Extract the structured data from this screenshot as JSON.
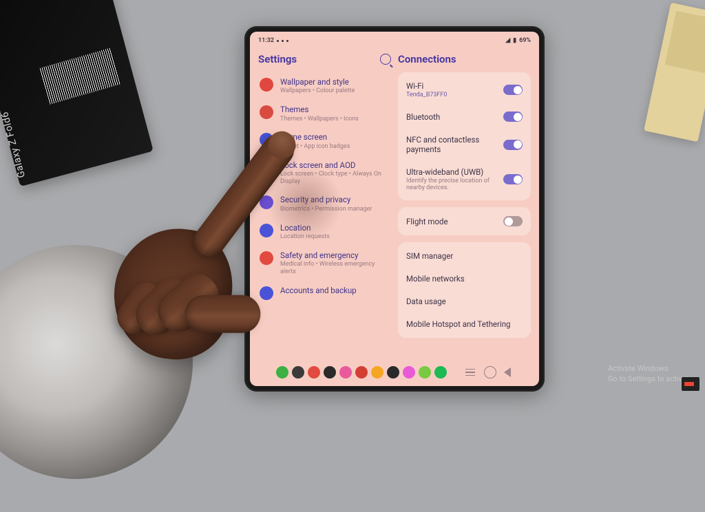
{
  "device_label": "Galaxy Z Fold6",
  "status": {
    "time": "11:32",
    "battery": "69%"
  },
  "left": {
    "title": "Settings",
    "items": [
      {
        "icon": "#e0483f",
        "title": "Wallpaper and style",
        "sub": "Wallpapers • Colour palette"
      },
      {
        "icon": "#d94a3f",
        "title": "Themes",
        "sub": "Themes • Wallpapers • Icons"
      },
      {
        "icon": "#4654d6",
        "title": "Home screen",
        "sub": "Layout • App icon badges"
      },
      {
        "icon": "#5a50c4",
        "title": "Lock screen and AOD",
        "sub": "Lock screen • Clock type • Always On Display"
      },
      {
        "icon": "#6a4fd0",
        "title": "Security and privacy",
        "sub": "Biometrics • Permission manager"
      },
      {
        "icon": "#4a52d8",
        "title": "Location",
        "sub": "Location requests"
      },
      {
        "icon": "#e24a3f",
        "title": "Safety and emergency",
        "sub": "Medical info • Wireless emergency alerts"
      },
      {
        "icon": "#4a52d8",
        "title": "Accounts and backup",
        "sub": ""
      }
    ]
  },
  "right": {
    "title": "Connections",
    "group1": [
      {
        "title": "Wi-Fi",
        "sub": "Tenda_B73FF0",
        "subcolor": "blue",
        "toggle": true
      },
      {
        "title": "Bluetooth",
        "toggle": true
      },
      {
        "title": "NFC and contactless payments",
        "toggle": true
      },
      {
        "title": "Ultra-wideband (UWB)",
        "sub": "Identify the precise location of nearby devices.",
        "subcolor": "grey",
        "toggle": true
      }
    ],
    "group2": [
      {
        "title": "Flight mode",
        "toggle": false
      }
    ],
    "group3": [
      {
        "title": "SIM manager"
      },
      {
        "title": "Mobile networks"
      },
      {
        "title": "Data usage"
      },
      {
        "title": "Mobile Hotspot and Tethering"
      }
    ]
  },
  "taskbar_colors": [
    "#3cb043",
    "#3a3a3a",
    "#e24a3f",
    "#2a2a2a",
    "#e85a9c",
    "#d43f34",
    "#f5a623",
    "#2a2a2a",
    "#e85ad6",
    "#7ac943",
    "#1db954"
  ],
  "watermark": {
    "l1": "Activate Windows",
    "l2": "Go to Settings to activate"
  }
}
